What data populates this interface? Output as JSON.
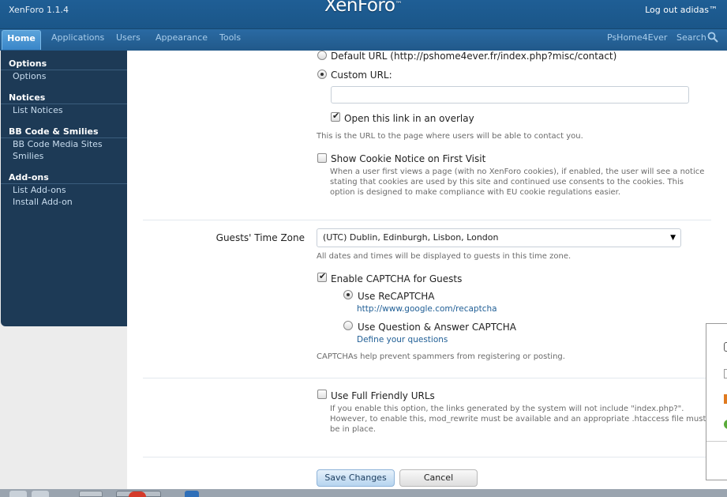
{
  "header": {
    "version": "XenForo 1.1.4",
    "logo": "XenForo",
    "logo_tm": "™",
    "logout": "Log out adidas™"
  },
  "tabs": [
    {
      "label": "Home",
      "active": true
    },
    {
      "label": "Applications"
    },
    {
      "label": "Users"
    },
    {
      "label": "Appearance"
    },
    {
      "label": "Tools"
    }
  ],
  "tabs_right": {
    "site": "PsHome4Ever",
    "search": "Search"
  },
  "sidebar": {
    "groups": [
      {
        "heading": "Options",
        "items": [
          "Options"
        ]
      },
      {
        "heading": "Notices",
        "items": [
          "List Notices"
        ]
      },
      {
        "heading": "BB Code & Smilies",
        "items": [
          "BB Code Media Sites",
          "Smilies"
        ]
      },
      {
        "heading": "Add-ons",
        "items": [
          "List Add-ons",
          "Install Add-on"
        ]
      }
    ]
  },
  "contact": {
    "default_url_label": "Default URL (http://pshome4ever.fr/index.php?misc/contact)",
    "default_url_checked": false,
    "custom_url_label": "Custom URL:",
    "custom_url_checked": true,
    "custom_url_value": "",
    "overlay_label": "Open this link in an overlay",
    "overlay_checked": true,
    "hint": "This is the URL to the page where users will be able to contact you."
  },
  "cookie": {
    "label": "Show Cookie Notice on First Visit",
    "checked": false,
    "hint_lines": [
      "When a user first views a page (with no XenForo cookies), if enabled, the user will see a notice",
      "stating that cookies are used by this site and continued use consents to the cookies. This",
      "option is designed to make compliance with EU cookie regulations easier."
    ]
  },
  "timezone": {
    "label": "Guests' Time Zone",
    "value": "(UTC) Dublin, Edinburgh, Lisbon, London",
    "hint": "All dates and times will be displayed to guests in this time zone."
  },
  "captcha": {
    "enable_label": "Enable CAPTCHA for Guests",
    "enable_checked": true,
    "recaptcha_label": "Use ReCAPTCHA",
    "recaptcha_checked": true,
    "recaptcha_link": "http://www.google.com/recaptcha",
    "qa_label": "Use Question & Answer CAPTCHA",
    "qa_checked": false,
    "qa_link": "Define your questions",
    "hint": "CAPTCHAs help prevent spammers from registering or posting."
  },
  "friendly_urls": {
    "label": "Use Full Friendly URLs",
    "checked": false,
    "hint_lines": [
      "If you enable this option, the links generated by the system will not include \"index.php?\".",
      "However, to enable this, mod_rewrite must be available and an appropriate .htaccess file must",
      "be in place."
    ]
  },
  "buttons": {
    "save": "Save Changes",
    "cancel": "Cancel"
  },
  "colors": {
    "header": "#1f5e95",
    "sidebar": "#1d3a56",
    "link": "#1f5e95"
  }
}
